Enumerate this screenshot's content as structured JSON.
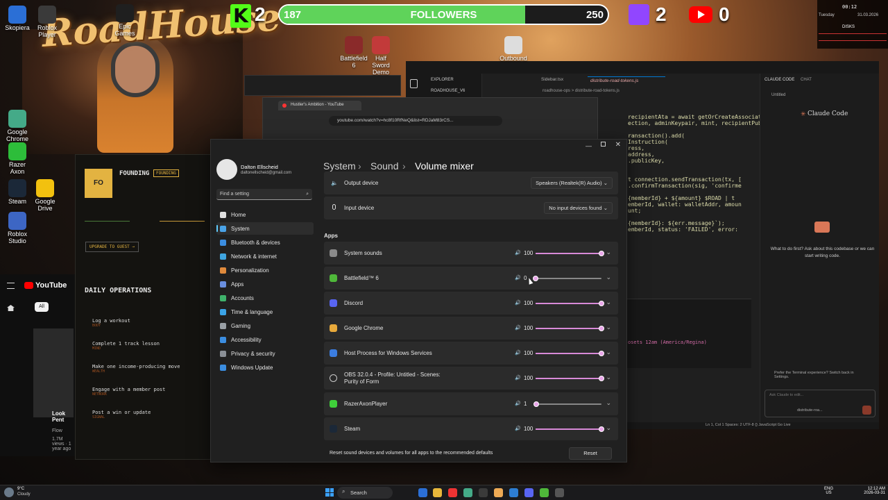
{
  "overlay": {
    "kick_count": "2",
    "followers_label": "FOLLOWERS",
    "followers_current": "187",
    "followers_goal": "250",
    "followers_progress": 0.748,
    "twitch_count": "2",
    "youtube_count": "0",
    "logo_text": "RoadHouse",
    "colors": {
      "kick": "#53fc18",
      "twitch": "#9146ff",
      "youtube": "#ff0000",
      "progress": "#5fd35a"
    }
  },
  "desktop_icons": [
    {
      "label": "Skopiera",
      "icon": "app-icon"
    },
    {
      "label": "Roblox Player",
      "icon": "roblox-icon"
    },
    {
      "label": "Epic Games",
      "icon": "epic-icon"
    },
    {
      "label": "Google Chrome",
      "icon": "chrome-icon"
    },
    {
      "label": "Razer Axon",
      "icon": "razer-icon"
    },
    {
      "label": "Steam",
      "icon": "steam-icon"
    },
    {
      "label": "Google Drive",
      "icon": "drive-icon"
    },
    {
      "label": "Roblox Studio",
      "icon": "roblox-studio-icon"
    },
    {
      "label": "Battlefield 6",
      "icon": "battlefield-icon"
    },
    {
      "label": "Half Sword Demo",
      "icon": "halfsword-icon"
    },
    {
      "label": "Outbound",
      "icon": "outbound-icon"
    }
  ],
  "background_app": {
    "founding_badge": "FO",
    "founding_title": "FOUNDING",
    "founding_tag": "FOUNDING",
    "upgrade_label": "UPGRADE TO GUEST →",
    "daily_ops_title": "DAILY OPERATIONS",
    "tasks": [
      {
        "title": "Log a workout",
        "tag": "BODY"
      },
      {
        "title": "Complete 1 track lesson",
        "tag": "MIND"
      },
      {
        "title": "Make one income-producing move",
        "tag": "WEALTH"
      },
      {
        "title": "Engage with a member post",
        "tag": "NETWORK"
      },
      {
        "title": "Post a win or update",
        "tag": "SIGNAL"
      }
    ]
  },
  "youtube_panel": {
    "brand": "YouTube",
    "chip_all": "All",
    "video_title": "Look Pent",
    "video_channel": "Flow",
    "video_meta": "1.7M views · 1 year ago"
  },
  "browser": {
    "tab_title": "Hustler's Ambition - YouTube",
    "url": "youtube.com/watch?v=hc8f10RfNeQ&list=RDJaM83rCS..."
  },
  "editor": {
    "explorer_label": "EXPLORER",
    "project": "ROADHOUSE_V6",
    "tabs": [
      "Sidebar.tsx",
      "distribute-road-tokens.js"
    ],
    "breadcrumb": "roadhouse-ops > distribute-road-tokens.js",
    "code_lines": [
      "recipientAta = await getOrCreateAssociatedTo",
      "ection, adminKeypair, mint, recipientPubkey",
      "",
      "ransaction().add(",
      "Instruction(",
      "ress,",
      "address,",
      ".publicKey,",
      "",
      "",
      "t connection.sendTransaction(tx, [",
      ".confirmTransaction(sig, 'confirme",
      "",
      "{memberId} + ${amount} $ROAD | t",
      "emberId, wallet: walletAddr, amoun",
      "unt;",
      "",
      "{memberId}: ${err.message}`);",
      "emberId, status: 'FAILED', error: "
    ],
    "terminal_text": "osets 12am (America/Regina)",
    "status_bar": "Ln 1, Col 1   Spaces: 2   UTF-8   {} JavaScript   Go Live"
  },
  "claude_panel": {
    "tab_code": "CLAUDE CODE",
    "tab_chat": "CHAT",
    "untitled": "Untitled",
    "title": "Claude Code",
    "prompt": "What to do first? Ask about this codebase or we can start writing code.",
    "terminal_hint": "Prefer the Terminal experience? Switch back in Settings.",
    "input_placeholder": "Ask Claude to edit...",
    "file_chip": "distribute-roa..."
  },
  "sys_monitor": {
    "time": "00:12",
    "day": "Tuesday",
    "date": "31.03.2026",
    "disks_label": "DISKS"
  },
  "settings": {
    "user_name": "Dalton Ellscheid",
    "user_email": "daltonellscheid@gmail.com",
    "search_placeholder": "Find a setting",
    "breadcrumb": [
      "System",
      "Sound",
      "Volume mixer"
    ],
    "nav": [
      {
        "label": "Home",
        "color": "#e0e0e0"
      },
      {
        "label": "System",
        "color": "#4aa3e8",
        "active": true
      },
      {
        "label": "Bluetooth & devices",
        "color": "#3b8de0"
      },
      {
        "label": "Network & internet",
        "color": "#3fa5e0"
      },
      {
        "label": "Personalization",
        "color": "#e08a3c"
      },
      {
        "label": "Apps",
        "color": "#6a8fe0"
      },
      {
        "label": "Accounts",
        "color": "#3fb26b"
      },
      {
        "label": "Time & language",
        "color": "#3ba4e8"
      },
      {
        "label": "Gaming",
        "color": "#9aa0a6"
      },
      {
        "label": "Accessibility",
        "color": "#3b8de0"
      },
      {
        "label": "Privacy & security",
        "color": "#8a8f96"
      },
      {
        "label": "Windows Update",
        "color": "#3b8de0"
      }
    ],
    "output_device_label": "Output device",
    "output_device_value": "Speakers (Realtek(R) Audio)",
    "input_device_label": "Input device",
    "input_device_value": "No input devices found",
    "apps_heading": "Apps",
    "apps": [
      {
        "name": "System sounds",
        "volume": "100",
        "level": 1.0,
        "muted": false,
        "color": "#8a8a8a"
      },
      {
        "name": "Battlefield™ 6",
        "volume": "0",
        "level": 0.0,
        "muted": false,
        "color": "#4fb83a"
      },
      {
        "name": "Discord",
        "volume": "100",
        "level": 1.0,
        "muted": false,
        "color": "#5865f2"
      },
      {
        "name": "Google Chrome",
        "volume": "100",
        "level": 1.0,
        "muted": false,
        "color": "#e8a93b"
      },
      {
        "name": "Host Process for Windows Services",
        "volume": "100",
        "level": 1.0,
        "muted": false,
        "color": "#3b7de0"
      },
      {
        "name": "OBS 32.0.4 - Profile: Untitled - Scenes: Purity of Form",
        "volume": "100",
        "level": 1.0,
        "muted": false,
        "color": "#2a2a2a"
      },
      {
        "name": "RazerAxonPlayer",
        "volume": "1",
        "level": 0.01,
        "muted": false,
        "color": "#3fcf3a"
      },
      {
        "name": "Steam",
        "volume": "100",
        "level": 1.0,
        "muted": false,
        "color": "#1b2838"
      }
    ],
    "reset_text": "Reset sound devices and volumes for all apps to the recommended defaults",
    "reset_button": "Reset"
  },
  "taskbar": {
    "weather_temp": "9°C",
    "weather_desc": "Cloudy",
    "search_label": "Search",
    "lang": "ENG",
    "region": "US",
    "time": "12:12 AM",
    "date": "2026-03-31"
  }
}
